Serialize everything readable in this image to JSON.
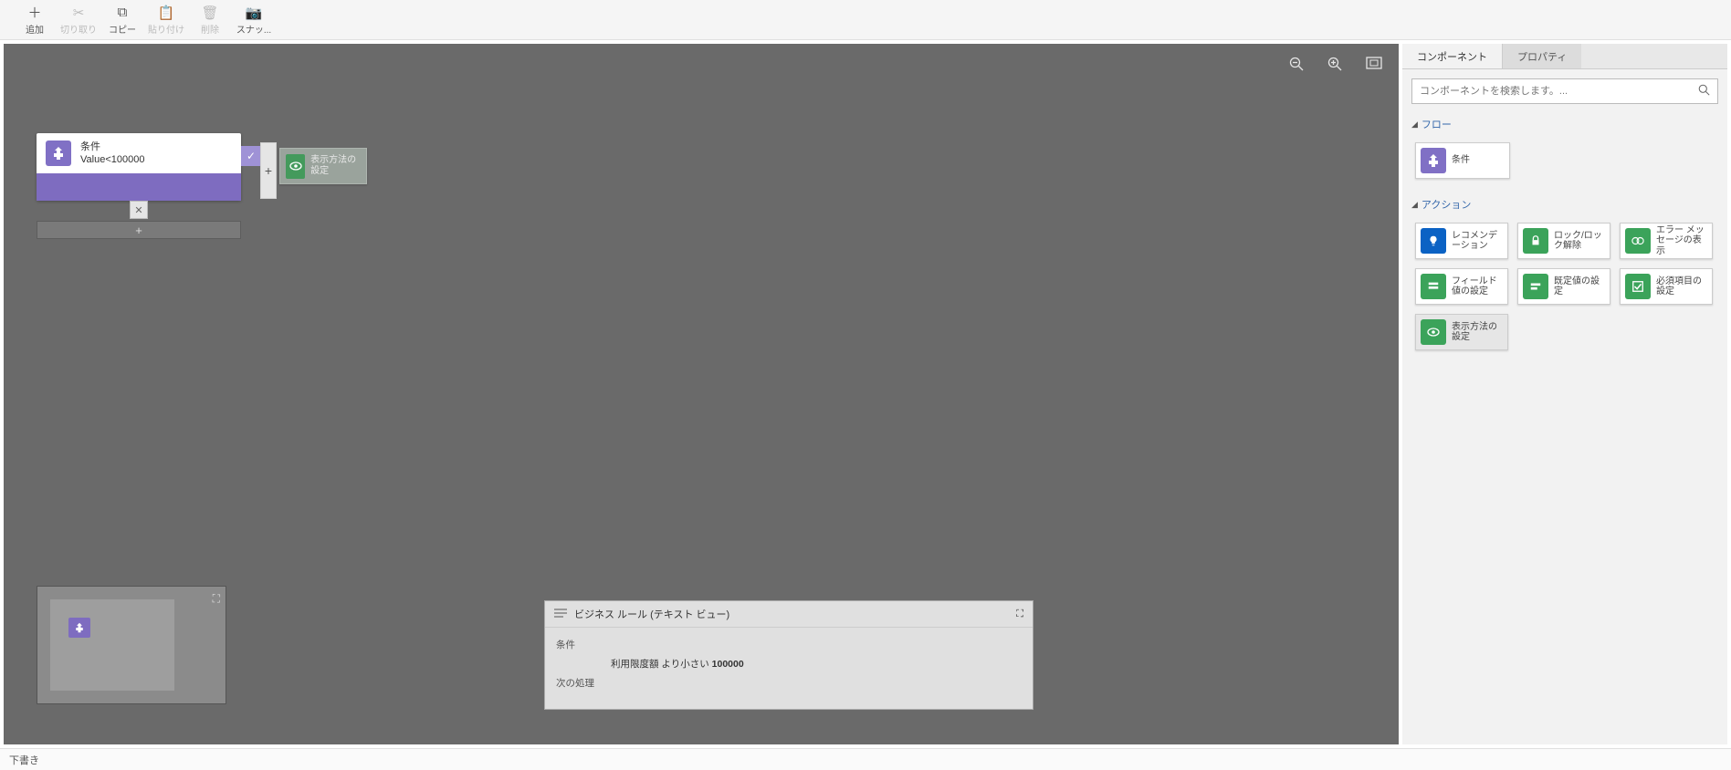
{
  "toolbar": {
    "add": "追加",
    "cut": "切り取り",
    "copy": "コピー",
    "paste": "貼り付け",
    "delete": "削除",
    "snap": "スナッ..."
  },
  "canvas": {
    "condition_title": "条件",
    "condition_expr": "Value<100000",
    "action_label": "表示方法の設定"
  },
  "textview": {
    "title": "ビジネス ルール (テキスト ビュー)",
    "section_if": "条件",
    "rule_field": "利用限度額",
    "rule_op": "より小さい",
    "rule_value": "100000",
    "section_then": "次の処理"
  },
  "panel": {
    "tab_components": "コンポーネント",
    "tab_properties": "プロパティ",
    "search_placeholder": "コンポーネントを検索します。...",
    "cat_flow": "フロー",
    "cat_action": "アクション",
    "flow_condition": "条件",
    "act_recommendation": "レコメンデーション",
    "act_lock": "ロック/ロック解除",
    "act_error": "エラー メッセージの表示",
    "act_setfield": "フィールド値の設定",
    "act_default": "既定値の設定",
    "act_required": "必須項目の設定",
    "act_visibility": "表示方法の設定"
  },
  "footer": {
    "status": "下書き"
  }
}
